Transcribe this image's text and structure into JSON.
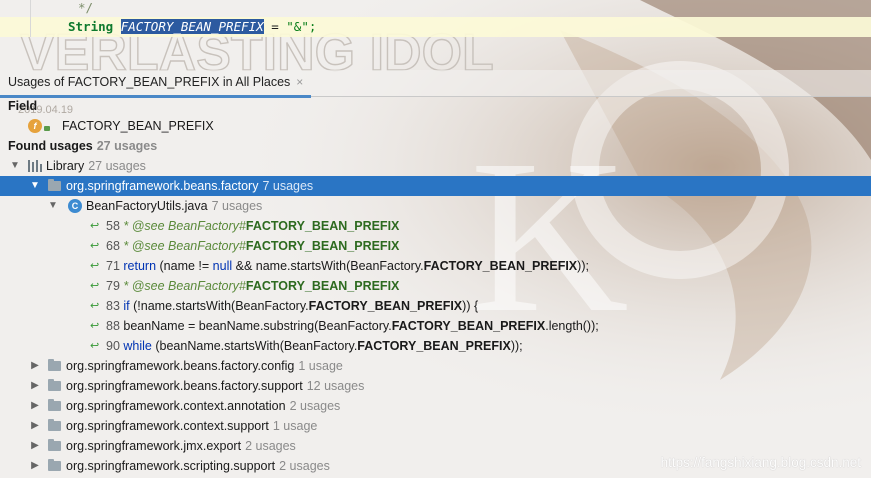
{
  "editor": {
    "line1": "*/",
    "line2_type": "String",
    "line2_name": "FACTORY_BEAN_PREFIX",
    "line2_rest": " = ",
    "line2_value": "\"&\";"
  },
  "tab": {
    "label": "Usages of FACTORY_BEAN_PREFIX in All Places",
    "close": "×"
  },
  "field_section": {
    "header": "Field",
    "name": "FACTORY_BEAN_PREFIX"
  },
  "found": {
    "label": "Found usages",
    "count": "27 usages"
  },
  "library": {
    "label": "Library",
    "count": "27 usages"
  },
  "packages": [
    {
      "name": "org.springframework.beans.factory",
      "count": "7 usages"
    },
    {
      "name": "org.springframework.beans.factory.config",
      "count": "1 usage"
    },
    {
      "name": "org.springframework.beans.factory.support",
      "count": "12 usages"
    },
    {
      "name": "org.springframework.context.annotation",
      "count": "2 usages"
    },
    {
      "name": "org.springframework.context.support",
      "count": "1 usage"
    },
    {
      "name": "org.springframework.jmx.export",
      "count": "2 usages"
    },
    {
      "name": "org.springframework.scripting.support",
      "count": "2 usages"
    }
  ],
  "file": {
    "name": "BeanFactoryUtils.java",
    "count": "7 usages"
  },
  "usages": [
    {
      "line": "58",
      "kw": "* @see BeanFactory#",
      "hl": "FACTORY_BEAN_PREFIX",
      "post": ""
    },
    {
      "line": "68",
      "kw": "* @see BeanFactory#",
      "hl": "FACTORY_BEAN_PREFIX",
      "post": ""
    },
    {
      "line": "71",
      "kw": "return",
      "pre": " (name != ",
      "kw2": "null",
      "pre2": " && name.startsWith(BeanFactory.",
      "hl": "FACTORY_BEAN_PREFIX",
      "post": "));"
    },
    {
      "line": "79",
      "kw": "* @see BeanFactory#",
      "hl": "FACTORY_BEAN_PREFIX",
      "post": ""
    },
    {
      "line": "83",
      "kw": "if",
      "pre": " (!name.startsWith(BeanFactory.",
      "hl": "FACTORY_BEAN_PREFIX",
      "post": ")) {"
    },
    {
      "line": "88",
      "pre": "beanName = beanName.substring(BeanFactory.",
      "hl": "FACTORY_BEAN_PREFIX",
      "post": ".length());"
    },
    {
      "line": "90",
      "kw": "while",
      "pre": " (beanName.startsWith(BeanFactory.",
      "hl": "FACTORY_BEAN_PREFIX",
      "post": "));"
    }
  ],
  "watermark": "https://fangshixiang.blog.csdn.net",
  "background_text": {
    "banner": "VERLASTING IDOL",
    "date": "2019.04.19",
    "letter": "K"
  },
  "colors": {
    "selection": "#2a75c4",
    "highlight_line": "#fcfad7",
    "usage_icon": "#3a9a3a",
    "keyword": "#0033b3"
  }
}
